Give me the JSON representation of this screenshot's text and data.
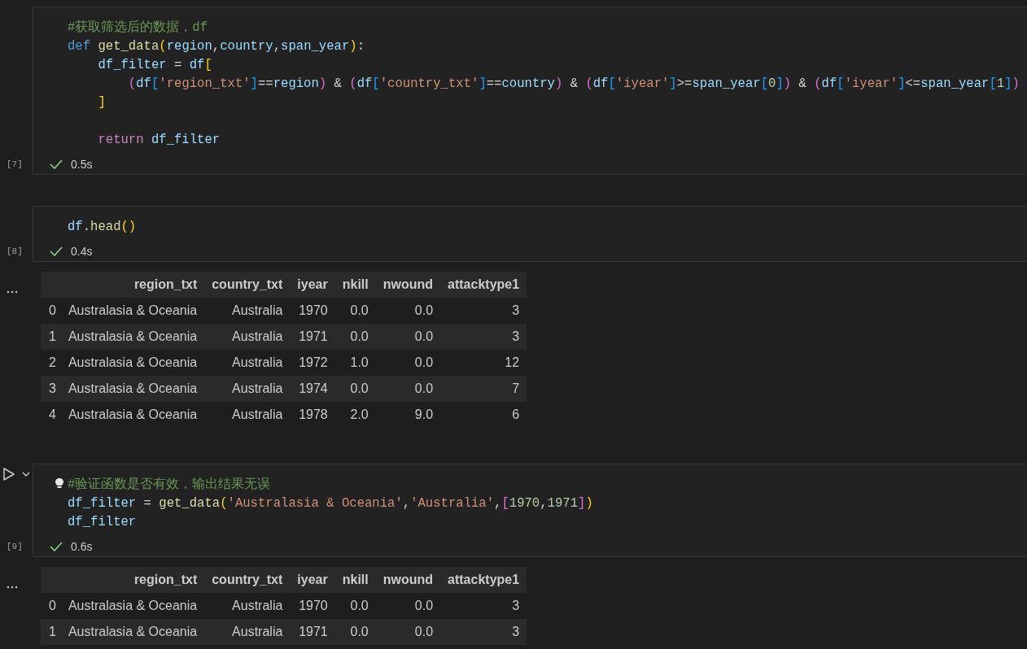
{
  "cells": [
    {
      "kind": "code",
      "focused": false,
      "execution_count": "[7]",
      "succeeded": true,
      "duration": "0.5s",
      "lines": [
        {
          "blank": false,
          "tokens": [
            {
              "kind": "comment",
              "t": "#获取筛选后的数据，df"
            }
          ]
        },
        {
          "blank": false,
          "tokens": [
            {
              "kind": "keyword",
              "t": "def "
            },
            {
              "kind": "func",
              "t": "get_data"
            },
            {
              "kind": "b1",
              "t": "("
            },
            {
              "kind": "var",
              "t": "region"
            },
            {
              "kind": "plain",
              "t": ","
            },
            {
              "kind": "var",
              "t": "country"
            },
            {
              "kind": "plain",
              "t": ","
            },
            {
              "kind": "var",
              "t": "span_year"
            },
            {
              "kind": "b1",
              "t": ")"
            },
            {
              "kind": "plain",
              "t": ":"
            }
          ]
        },
        {
          "blank": false,
          "tokens": [
            {
              "kind": "var",
              "t": "    df_filter"
            },
            {
              "kind": "plain",
              "t": " = "
            },
            {
              "kind": "var",
              "t": "df"
            },
            {
              "kind": "b1",
              "t": "["
            }
          ]
        },
        {
          "blank": false,
          "tokens": [
            {
              "kind": "b2",
              "t": "        ("
            },
            {
              "kind": "var",
              "t": "df"
            },
            {
              "kind": "b3",
              "t": "["
            },
            {
              "kind": "string",
              "t": "'region_txt'"
            },
            {
              "kind": "b3",
              "t": "]"
            },
            {
              "kind": "plain",
              "t": "=="
            },
            {
              "kind": "var",
              "t": "region"
            },
            {
              "kind": "b2",
              "t": ")"
            },
            {
              "kind": "plain",
              "t": " & "
            },
            {
              "kind": "b2",
              "t": "("
            },
            {
              "kind": "var",
              "t": "df"
            },
            {
              "kind": "b3",
              "t": "["
            },
            {
              "kind": "string",
              "t": "'country_txt'"
            },
            {
              "kind": "b3",
              "t": "]"
            },
            {
              "kind": "plain",
              "t": "=="
            },
            {
              "kind": "var",
              "t": "country"
            },
            {
              "kind": "b2",
              "t": ")"
            },
            {
              "kind": "plain",
              "t": " & "
            },
            {
              "kind": "b2",
              "t": "("
            },
            {
              "kind": "var",
              "t": "df"
            },
            {
              "kind": "b3",
              "t": "["
            },
            {
              "kind": "string",
              "t": "'iyear'"
            },
            {
              "kind": "b3",
              "t": "]"
            },
            {
              "kind": "plain",
              "t": ">="
            },
            {
              "kind": "var",
              "t": "span_year"
            },
            {
              "kind": "b3",
              "t": "["
            },
            {
              "kind": "number",
              "t": "0"
            },
            {
              "kind": "b3",
              "t": "]"
            },
            {
              "kind": "b2",
              "t": ")"
            },
            {
              "kind": "plain",
              "t": " & "
            },
            {
              "kind": "b2",
              "t": "("
            },
            {
              "kind": "var",
              "t": "df"
            },
            {
              "kind": "b3",
              "t": "["
            },
            {
              "kind": "string",
              "t": "'iyear'"
            },
            {
              "kind": "b3",
              "t": "]"
            },
            {
              "kind": "plain",
              "t": "<="
            },
            {
              "kind": "var",
              "t": "span_year"
            },
            {
              "kind": "b3",
              "t": "["
            },
            {
              "kind": "number",
              "t": "1"
            },
            {
              "kind": "b3",
              "t": "]"
            },
            {
              "kind": "b2",
              "t": ")"
            }
          ]
        },
        {
          "blank": false,
          "tokens": [
            {
              "kind": "b1",
              "t": "    ]"
            }
          ]
        },
        {
          "blank": true
        },
        {
          "blank": false,
          "tokens": [
            {
              "kind": "control",
              "t": "    return "
            },
            {
              "kind": "var",
              "t": "df_filter"
            }
          ]
        }
      ]
    },
    {
      "kind": "code",
      "focused": false,
      "execution_count": "[8]",
      "succeeded": true,
      "duration": "0.4s",
      "lines": [
        {
          "blank": false,
          "tokens": [
            {
              "kind": "var",
              "t": "df"
            },
            {
              "kind": "plain",
              "t": "."
            },
            {
              "kind": "func",
              "t": "head"
            },
            {
              "kind": "b1",
              "t": "()"
            }
          ]
        }
      ],
      "output": {
        "columns": [
          "region_txt",
          "country_txt",
          "iyear",
          "nkill",
          "nwound",
          "attacktype1"
        ],
        "rows": [
          {
            "index": "0",
            "cells": [
              "Australasia & Oceania",
              "Australia",
              "1970",
              "0.0",
              "0.0",
              "3"
            ]
          },
          {
            "index": "1",
            "cells": [
              "Australasia & Oceania",
              "Australia",
              "1971",
              "0.0",
              "0.0",
              "3"
            ]
          },
          {
            "index": "2",
            "cells": [
              "Australasia & Oceania",
              "Australia",
              "1972",
              "1.0",
              "0.0",
              "12"
            ]
          },
          {
            "index": "3",
            "cells": [
              "Australasia & Oceania",
              "Australia",
              "1974",
              "0.0",
              "0.0",
              "7"
            ]
          },
          {
            "index": "4",
            "cells": [
              "Australasia & Oceania",
              "Australia",
              "1978",
              "2.0",
              "9.0",
              "6"
            ]
          }
        ]
      }
    },
    {
      "kind": "code",
      "focused": true,
      "execution_count": "[9]",
      "succeeded": true,
      "duration": "0.6s",
      "lines": [
        {
          "blank": false,
          "tokens": [
            {
              "kind": "comment",
              "t": "#验证函数是否有效，输出结果无误"
            }
          ]
        },
        {
          "blank": false,
          "tokens": [
            {
              "kind": "var",
              "t": "df_filter"
            },
            {
              "kind": "plain",
              "t": " = "
            },
            {
              "kind": "func",
              "t": "get_data"
            },
            {
              "kind": "b1",
              "t": "("
            },
            {
              "kind": "string",
              "t": "'Australasia & Oceania'"
            },
            {
              "kind": "plain",
              "t": ","
            },
            {
              "kind": "string",
              "t": "'Australia'"
            },
            {
              "kind": "plain",
              "t": ","
            },
            {
              "kind": "b2",
              "t": "["
            },
            {
              "kind": "number",
              "t": "1970"
            },
            {
              "kind": "plain",
              "t": ","
            },
            {
              "kind": "number",
              "t": "1971"
            },
            {
              "kind": "b2",
              "t": "]"
            },
            {
              "kind": "b1",
              "t": ")"
            }
          ]
        },
        {
          "blank": false,
          "tokens": [
            {
              "kind": "var",
              "t": "df_filter"
            }
          ]
        }
      ],
      "output": {
        "columns": [
          "region_txt",
          "country_txt",
          "iyear",
          "nkill",
          "nwound",
          "attacktype1"
        ],
        "rows": [
          {
            "index": "0",
            "cells": [
              "Australasia & Oceania",
              "Australia",
              "1970",
              "0.0",
              "0.0",
              "3"
            ]
          },
          {
            "index": "1",
            "cells": [
              "Australasia & Oceania",
              "Australia",
              "1971",
              "0.0",
              "0.0",
              "3"
            ]
          }
        ]
      }
    }
  ]
}
